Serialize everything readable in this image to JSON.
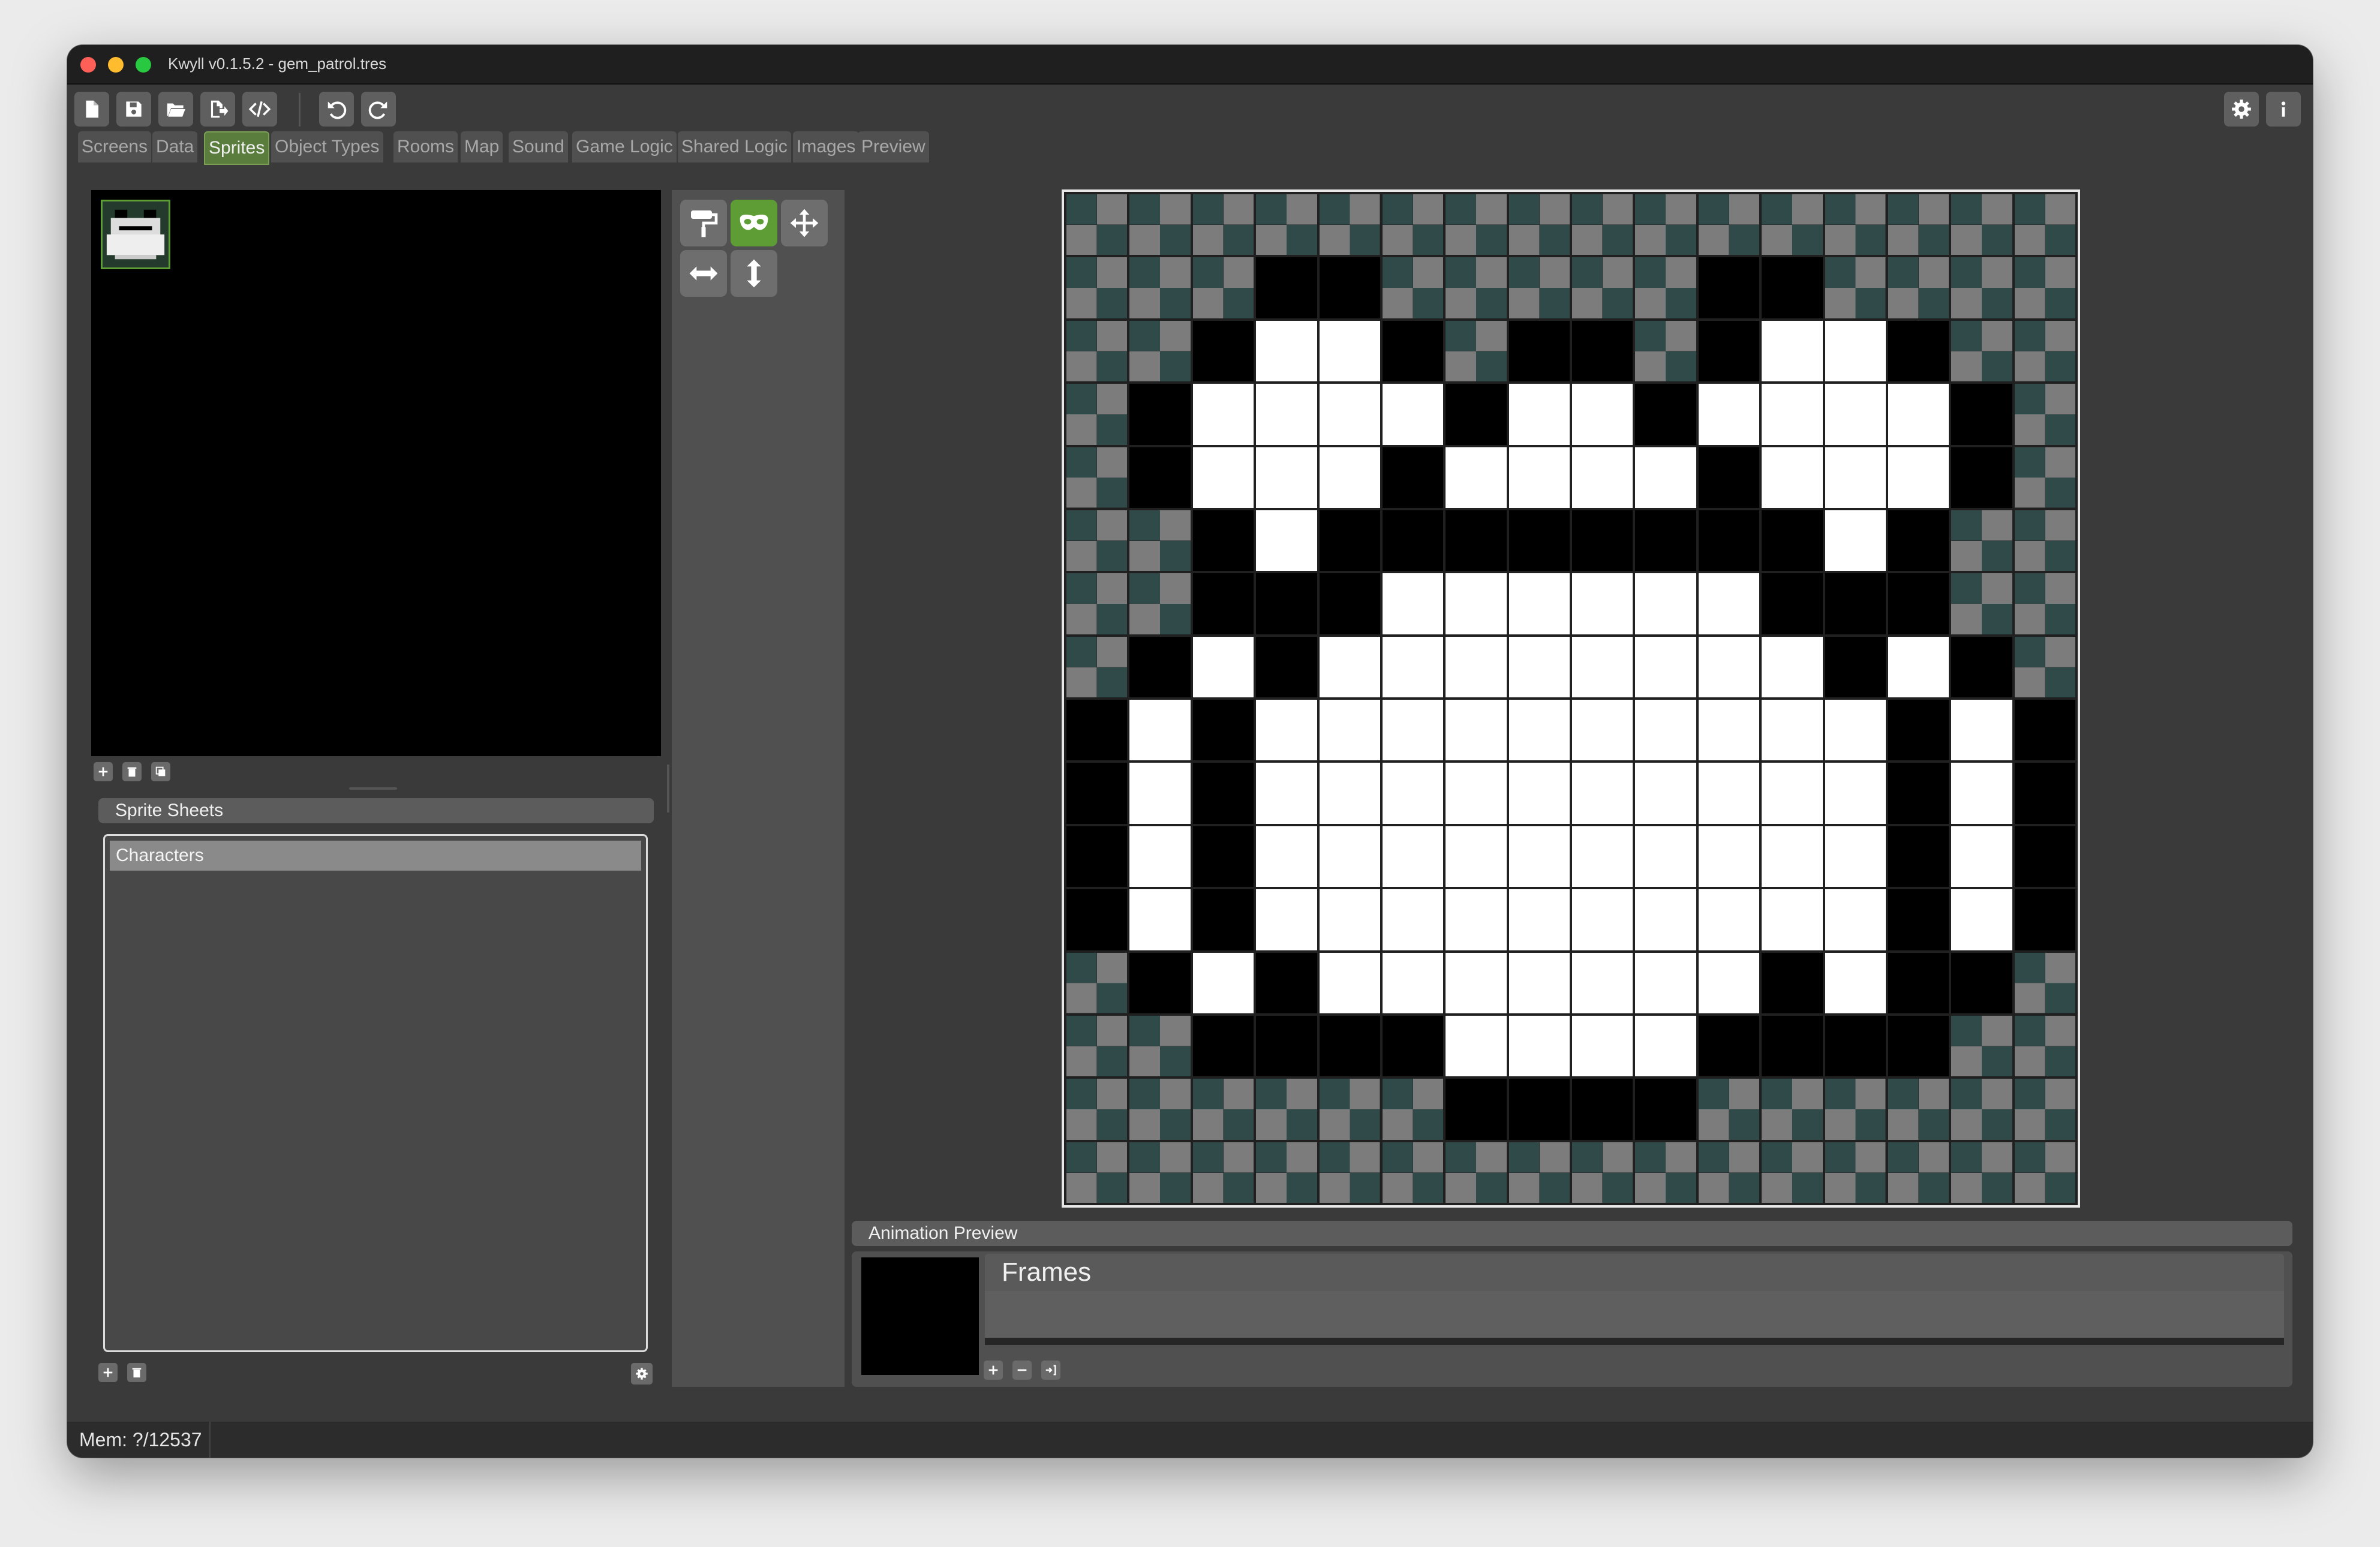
{
  "window": {
    "title": "Kwyll v0.1.5.2 - gem_patrol.tres"
  },
  "toolbar": {
    "buttons": [
      "new-file-icon",
      "save-icon",
      "open-folder-icon",
      "export-icon",
      "code-icon",
      "undo-icon",
      "redo-icon"
    ],
    "right_buttons": [
      "gear-icon",
      "info-icon"
    ]
  },
  "tabs": [
    {
      "label": "Screens"
    },
    {
      "label": "Data"
    },
    {
      "label": "Sprites",
      "active": true
    },
    {
      "label": "Object Types"
    },
    {
      "label": "Rooms"
    },
    {
      "label": "Map"
    },
    {
      "label": "Sound"
    },
    {
      "label": "Game Logic"
    },
    {
      "label": "Shared Logic"
    },
    {
      "label": "Images"
    },
    {
      "label": "Preview"
    }
  ],
  "sprite_sheets": {
    "header": "Sprite Sheets",
    "items": [
      "Characters"
    ],
    "selected": "Characters"
  },
  "tools": [
    "paint-roller-icon",
    "mask-icon",
    "move-icon",
    "flip-horizontal-icon",
    "flip-vertical-icon"
  ],
  "active_tool": "mask-icon",
  "sprite_editor": {
    "size": "16x16",
    "pixels": [
      "TTTTTTTTTTTTTTTT",
      "TTTBBTTTTTBBTTTT",
      "TTBWWBTBBTBWWBTT",
      "TBWWWWBWWBWWWWBT",
      "TBWWWBWWWWBWWWBT",
      "TTBWBBBBBBBBWBTT",
      "TTBBBWWWWWWBBBTT",
      "TBWBWWWWWWWWBWBT",
      "BWBWWWWWWWWWWBWB",
      "BWBWWWWWWWWWWBWB",
      "BWBWWWWWWWWWWBWB",
      "BWBWWWWWWWWWWBWB",
      "TBWBWWWWWWWBWBBT",
      "TTBBBBWWWWBBBBTT",
      "TTTTTTBBBBTTTTTT",
      "TTTTTTTTTTTTTTTT"
    ],
    "legend": {
      "T": "transparent",
      "B": "#000000",
      "W": "#ffffff"
    }
  },
  "animation": {
    "header": "Animation Preview",
    "frames_title": "Frames"
  },
  "status": {
    "mem": "Mem: ?/12537"
  },
  "colors": {
    "accent_green": "#5e9c35",
    "panel": "#505050",
    "background": "#3a3a3a"
  }
}
